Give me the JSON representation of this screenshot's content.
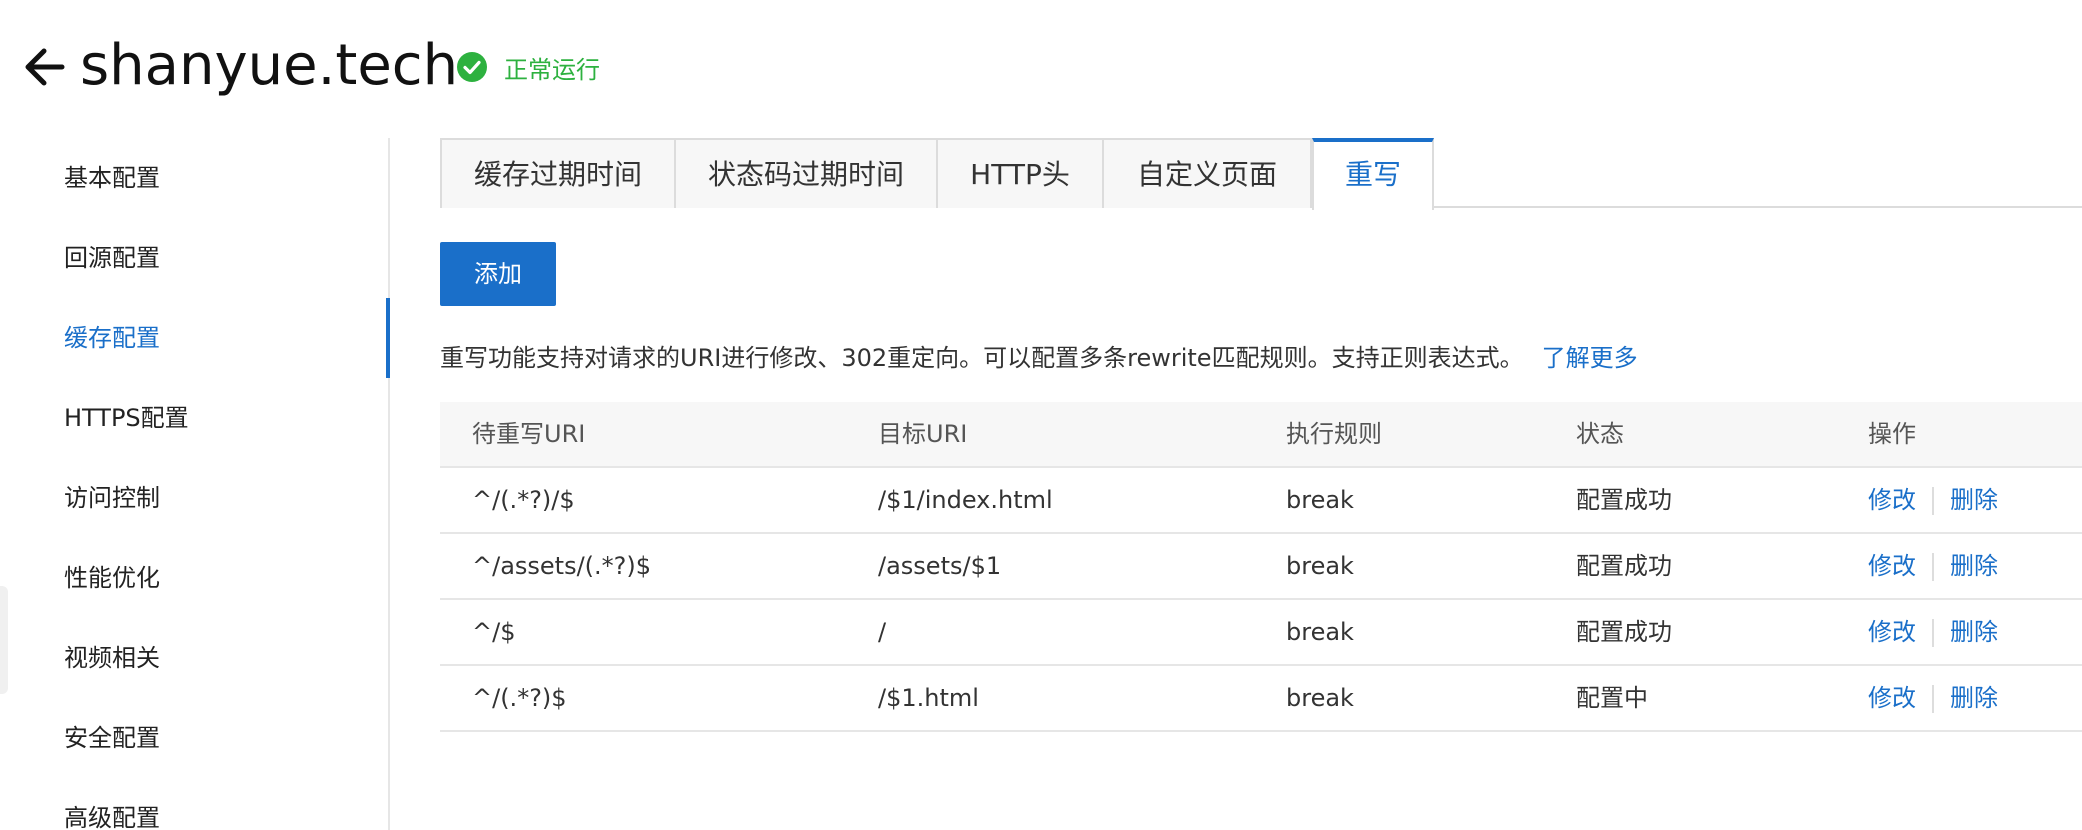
{
  "header": {
    "title": "shanyue.tech",
    "status": "正常运行"
  },
  "sidebar": {
    "items": [
      {
        "label": "基本配置"
      },
      {
        "label": "回源配置"
      },
      {
        "label": "缓存配置"
      },
      {
        "label": "HTTPS配置"
      },
      {
        "label": "访问控制"
      },
      {
        "label": "性能优化"
      },
      {
        "label": "视频相关"
      },
      {
        "label": "安全配置"
      },
      {
        "label": "高级配置"
      }
    ],
    "active_index": 2
  },
  "tabs": [
    {
      "label": "缓存过期时间"
    },
    {
      "label": "状态码过期时间"
    },
    {
      "label": "HTTP头"
    },
    {
      "label": "自定义页面"
    },
    {
      "label": "重写"
    }
  ],
  "toolbar": {
    "add_label": "添加"
  },
  "description": {
    "text": "重写功能支持对请求的URI进行修改、302重定向。可以配置多条rewrite匹配规则。支持正则表达式。",
    "link": "了解更多"
  },
  "table": {
    "headers": [
      "待重写URI",
      "目标URI",
      "执行规则",
      "状态",
      "操作"
    ],
    "rows": [
      {
        "source": "^/(.*?)/$",
        "target": "/$1/index.html",
        "rule": "break",
        "status": "配置成功",
        "edit": "修改",
        "delete": "删除"
      },
      {
        "source": "^/assets/(.*?)$",
        "target": "/assets/$1",
        "rule": "break",
        "status": "配置成功",
        "edit": "修改",
        "delete": "删除"
      },
      {
        "source": "^/$",
        "target": "/",
        "rule": "break",
        "status": "配置成功",
        "edit": "修改",
        "delete": "删除"
      },
      {
        "source": "^/(.*?)$",
        "target": "/$1.html",
        "rule": "break",
        "status": "配置中",
        "edit": "修改",
        "delete": "删除"
      }
    ]
  },
  "colors": {
    "accent": "#1a6fc9",
    "success": "#2db13f"
  }
}
